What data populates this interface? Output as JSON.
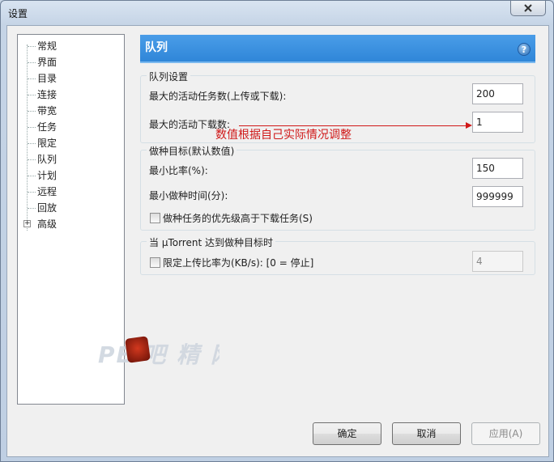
{
  "window": {
    "title": "设置"
  },
  "tree": {
    "items": [
      {
        "label": "常规"
      },
      {
        "label": "界面"
      },
      {
        "label": "目录"
      },
      {
        "label": "连接"
      },
      {
        "label": "带宽"
      },
      {
        "label": "任务"
      },
      {
        "label": "限定"
      },
      {
        "label": "队列"
      },
      {
        "label": "计划"
      },
      {
        "label": "远程"
      },
      {
        "label": "回放"
      },
      {
        "label": "高级",
        "expander": "+"
      }
    ],
    "selected": "队列"
  },
  "panel": {
    "title": "队列",
    "help": "?",
    "queue_group": {
      "legend": "队列设置",
      "max_active_label": "最大的活动任务数(上传或下载):",
      "max_active_value": "200",
      "max_download_label": "最大的活动下载数:",
      "max_download_value": "1"
    },
    "seed_group": {
      "legend": "做种目标(默认数值)",
      "min_ratio_label": "最小比率(%):",
      "min_ratio_value": "150",
      "min_time_label": "最小做种时间(分):",
      "min_time_value": "999999",
      "priority_label": "做种任务的优先级高于下载任务(S)"
    },
    "target_group": {
      "legend": "当 µTorrent 达到做种目标时",
      "limit_label": "限定上传比率为(KB/s): [0 = 停止]",
      "limit_value": "4"
    }
  },
  "annotation": {
    "text": "数值根据自己实际情况调整",
    "color": "#d01818"
  },
  "buttons": {
    "ok": "确定",
    "cancel": "取消",
    "apply": "应用(A)"
  },
  "colors": {
    "header_blue": "#2f86d8",
    "accent_red": "#d01818"
  }
}
